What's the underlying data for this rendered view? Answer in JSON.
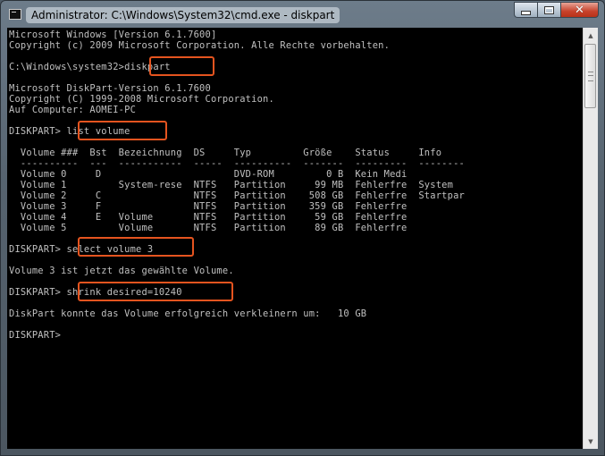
{
  "window": {
    "title": "Administrator: C:\\Windows\\System32\\cmd.exe - diskpart",
    "icon": "cmd-icon",
    "buttons": {
      "minimize": "minimize-icon",
      "maximize": "maximize-icon",
      "close": "close-icon"
    }
  },
  "console": {
    "lines": [
      "Microsoft Windows [Version 6.1.7600]",
      "Copyright (c) 2009 Microsoft Corporation. Alle Rechte vorbehalten.",
      "",
      "C:\\Windows\\system32>diskpart",
      "",
      "Microsoft DiskPart-Version 6.1.7600",
      "Copyright (C) 1999-2008 Microsoft Corporation.",
      "Auf Computer: AOMEI-PC",
      "",
      "DISKPART> list volume",
      "",
      "  Volume ###  Bst  Bezeichnung  DS     Typ         Größe    Status     Info",
      "  ----------  ---  -----------  -----  ----------  -------  ---------  --------",
      "  Volume 0     D                       DVD-ROM         0 B  Kein Medi",
      "  Volume 1         System-rese  NTFS   Partition     99 MB  Fehlerfre  System",
      "  Volume 2     C                NTFS   Partition    508 GB  Fehlerfre  Startpar",
      "  Volume 3     F                NTFS   Partition    359 GB  Fehlerfre",
      "  Volume 4     E   Volume       NTFS   Partition     59 GB  Fehlerfre",
      "  Volume 5         Volume       NTFS   Partition     89 GB  Fehlerfre",
      "",
      "DISKPART> select volume 3",
      "",
      "Volume 3 ist jetzt das gewählte Volume.",
      "",
      "DISKPART> shrink desired=10240",
      "",
      "DiskPart konnte das Volume erfolgreich verkleinern um:   10 GB",
      "",
      "DISKPART> "
    ]
  },
  "highlight_color": "#e5541f"
}
